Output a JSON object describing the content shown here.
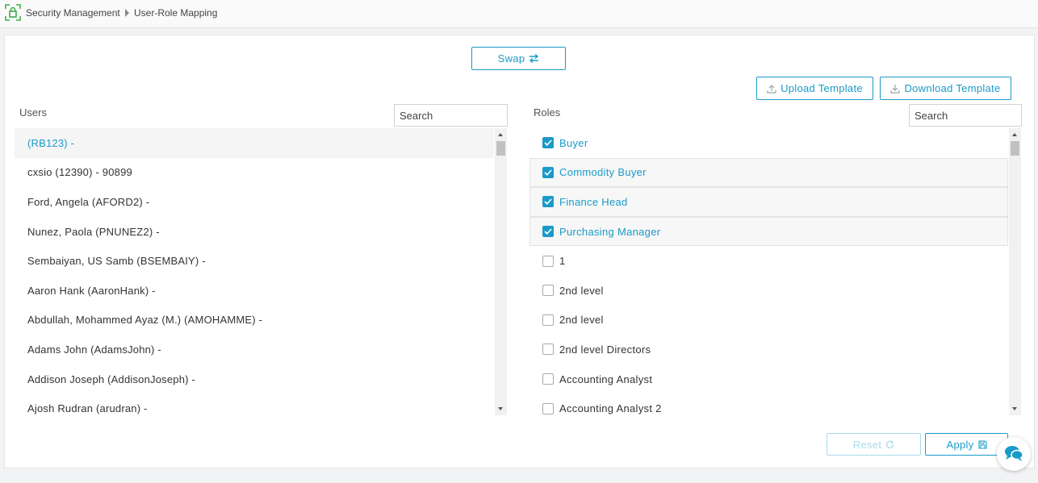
{
  "breadcrumb": {
    "section": "Security Management",
    "page": "User-Role Mapping"
  },
  "toolbar": {
    "swap_label": "Swap",
    "upload_label": "Upload Template",
    "download_label": "Download Template"
  },
  "users": {
    "label": "Users",
    "search_placeholder": "Search",
    "items": [
      {
        "label": "(RB123) -",
        "selected": true
      },
      {
        "label": "cxsio (12390) - 90899",
        "selected": false
      },
      {
        "label": "Ford, Angela (AFORD2) -",
        "selected": false
      },
      {
        "label": "Nunez, Paola (PNUNEZ2) -",
        "selected": false
      },
      {
        "label": "Sembaiyan, US Samb (BSEMBAIY) -",
        "selected": false
      },
      {
        "label": "Aaron Hank (AaronHank) -",
        "selected": false
      },
      {
        "label": "Abdullah, Mohammed Ayaz (M.) (AMOHAMME) -",
        "selected": false
      },
      {
        "label": "Adams John (AdamsJohn) -",
        "selected": false
      },
      {
        "label": "Addison Joseph (AddisonJoseph) -",
        "selected": false
      },
      {
        "label": "Ajosh Rudran (arudran) -",
        "selected": false
      }
    ]
  },
  "roles": {
    "label": "Roles",
    "search_placeholder": "Search",
    "items": [
      {
        "label": "Buyer",
        "checked": true
      },
      {
        "label": "Commodity Buyer",
        "checked": true
      },
      {
        "label": "Finance Head",
        "checked": true
      },
      {
        "label": "Purchasing Manager",
        "checked": true
      },
      {
        "label": "1",
        "checked": false
      },
      {
        "label": "2nd level",
        "checked": false
      },
      {
        "label": "2nd level",
        "checked": false
      },
      {
        "label": "2nd level Directors",
        "checked": false
      },
      {
        "label": "Accounting Analyst",
        "checked": false
      },
      {
        "label": "Accounting Analyst 2",
        "checked": false
      }
    ]
  },
  "footer": {
    "reset_label": "Reset",
    "apply_label": "Apply"
  },
  "colors": {
    "accent": "#1a9ac9",
    "accent_disabled": "#a9dbee",
    "logo_green": "#3fae49"
  },
  "icons": {
    "logo": "lock-shield-icon",
    "swap": "swap-arrows-icon",
    "upload": "upload-icon",
    "download": "download-icon",
    "reset": "refresh-icon",
    "apply": "save-icon",
    "chat": "chat-icon"
  }
}
